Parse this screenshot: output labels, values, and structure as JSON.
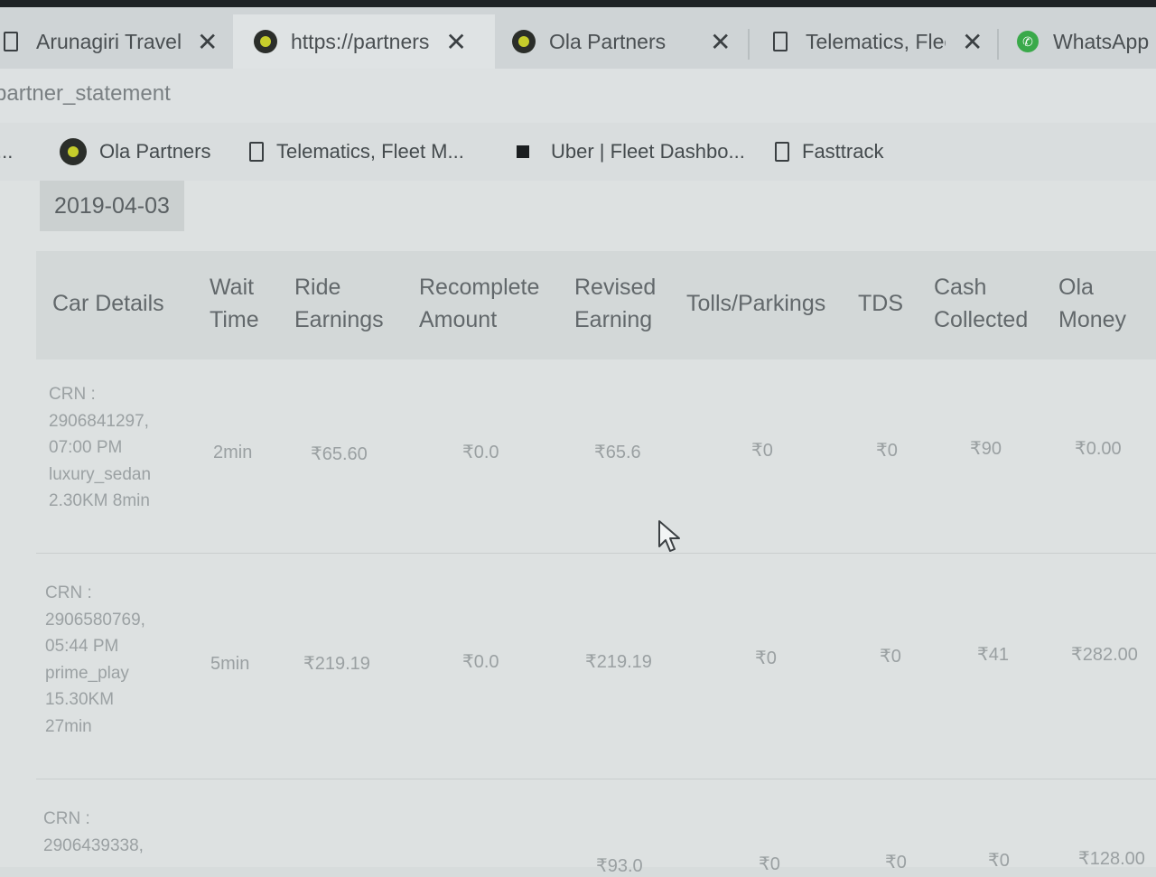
{
  "browser": {
    "tabs": [
      {
        "label": "Arunagiri Travel",
        "icon": "doc-icon",
        "closable": true,
        "active": false
      },
      {
        "label": "https://partners",
        "icon": "ola-icon",
        "closable": true,
        "active": true
      },
      {
        "label": "Ola Partners",
        "icon": "ola-icon",
        "closable": true,
        "active": false
      },
      {
        "label": "Telematics, Fleet",
        "icon": "doc-icon",
        "closable": true,
        "active": false
      },
      {
        "label": "WhatsApp",
        "icon": "whatsapp-icon",
        "closable": false,
        "active": false
      }
    ],
    "close_glyph": "✕",
    "address": "partner_statement",
    "bookmarks": [
      {
        "label": "...",
        "icon": ""
      },
      {
        "label": "Ola Partners",
        "icon": "ola-icon"
      },
      {
        "label": "Telematics, Fleet M...",
        "icon": "doc-icon"
      },
      {
        "label": "Uber | Fleet Dashbo...",
        "icon": "square-icon"
      },
      {
        "label": "Fasttrack",
        "icon": "doc-icon"
      }
    ]
  },
  "page": {
    "date": "2019-04-03",
    "columns": [
      {
        "line1": "Car Details",
        "line2": ""
      },
      {
        "line1": "Wait",
        "line2": "Time"
      },
      {
        "line1": "Ride",
        "line2": "Earnings"
      },
      {
        "line1": "Recomplete",
        "line2": "Amount"
      },
      {
        "line1": "Revised",
        "line2": "Earning"
      },
      {
        "line1": "Tolls/Parkings",
        "line2": ""
      },
      {
        "line1": "TDS",
        "line2": ""
      },
      {
        "line1": "Cash",
        "line2": "Collected"
      },
      {
        "line1": "Ola",
        "line2": "Money"
      }
    ],
    "rows": [
      {
        "car_details": [
          "CRN :",
          "2906841297,",
          "07:00 PM",
          "luxury_sedan",
          "2.30KM 8min"
        ],
        "wait_time": "2min",
        "ride_earnings": "₹65.60",
        "recomplete_amount": "₹0.0",
        "revised_earning": "₹65.6",
        "tolls_parkings": "₹0",
        "tds": "₹0",
        "cash_collected": "₹90",
        "ola_money": "₹0.00"
      },
      {
        "car_details": [
          "CRN :",
          "2906580769,",
          "05:44 PM",
          "prime_play",
          "15.30KM",
          "27min"
        ],
        "wait_time": "5min",
        "ride_earnings": "₹219.19",
        "recomplete_amount": "₹0.0",
        "revised_earning": "₹219.19",
        "tolls_parkings": "₹0",
        "tds": "₹0",
        "cash_collected": "₹41",
        "ola_money": "₹282.00"
      },
      {
        "car_details": [
          "CRN :",
          "2906439338,"
        ],
        "wait_time": "",
        "ride_earnings": "",
        "recomplete_amount": "",
        "revised_earning": "₹93.0",
        "tolls_parkings": "₹0",
        "tds": "₹0",
        "cash_collected": "₹0",
        "ola_money": "₹128.00"
      }
    ]
  }
}
